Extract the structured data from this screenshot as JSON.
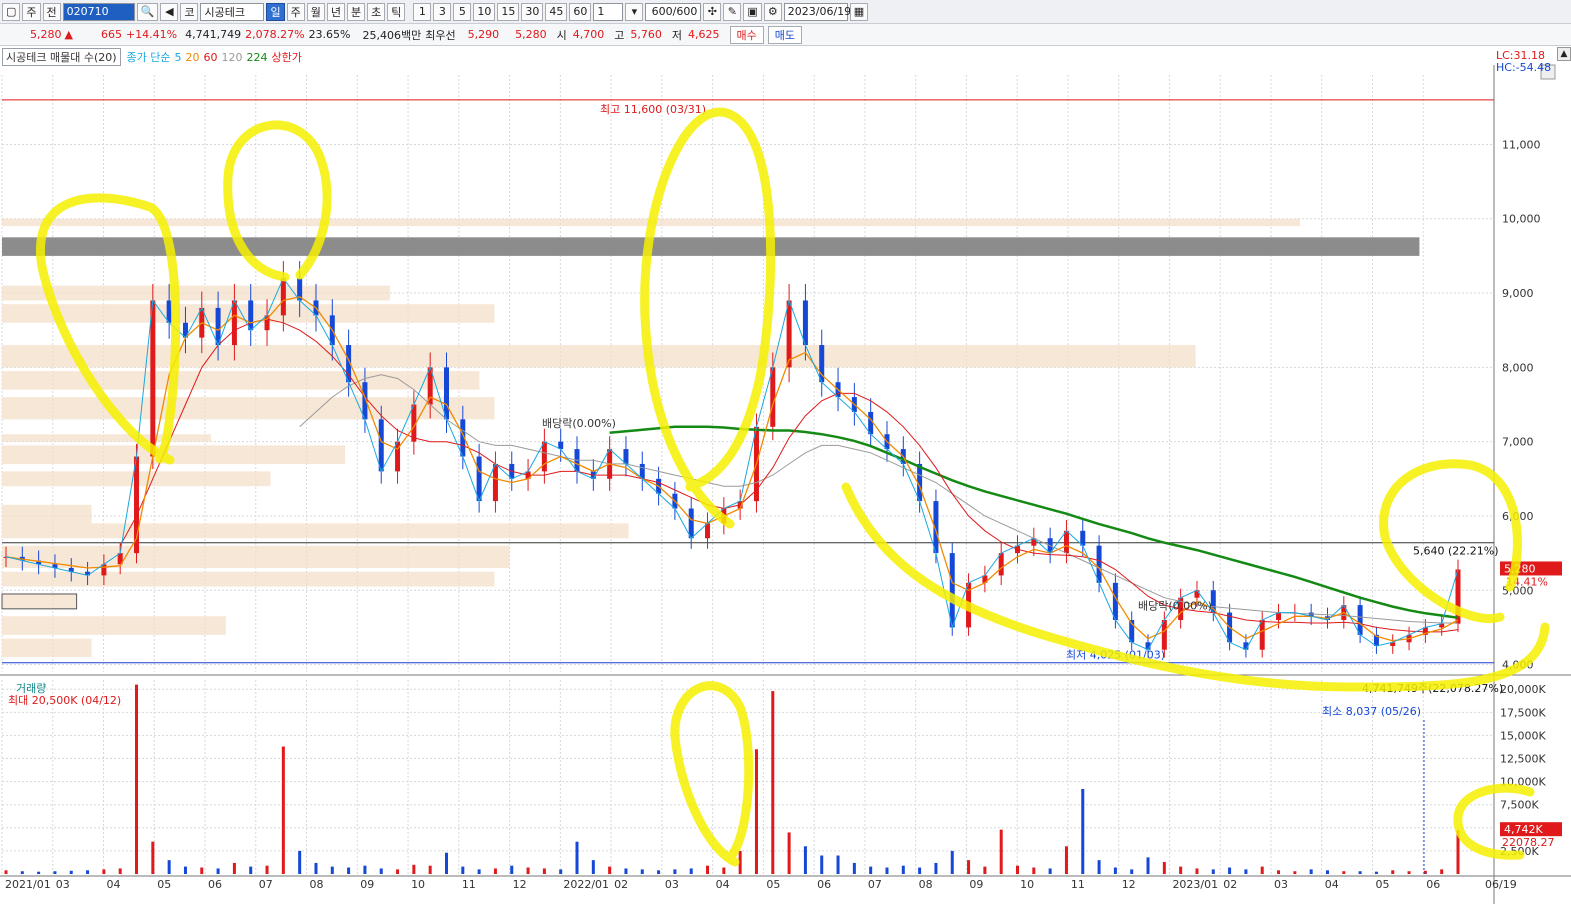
{
  "toolbar": {
    "market_label": "주",
    "prev_label": "전",
    "stock_code": "020710",
    "code_type": "코",
    "stock_name": "시공테크",
    "periods": [
      "일",
      "주",
      "월",
      "년",
      "분",
      "초",
      "틱"
    ],
    "selected_period": "일",
    "intervals": [
      "1",
      "3",
      "5",
      "10",
      "15",
      "30",
      "45",
      "60"
    ],
    "multiplier": "1",
    "count": "600/600",
    "date": "2023/06/19"
  },
  "quote": {
    "price": "5,280",
    "arrow": "▲",
    "change": "665",
    "change_pct": "+14.41%",
    "volume": "4,741,749",
    "volume_pct": "2,078.27%",
    "turnover": "23.65%",
    "amount": "25,406백만",
    "best_bid_label": "최우선",
    "best_ask": "5,290",
    "best_bid": "5,280",
    "open_label": "시",
    "open": "4,700",
    "high_label": "고",
    "high": "5,760",
    "low_label": "저",
    "low": "4,625",
    "buy_label": "매수",
    "sell_label": "매도"
  },
  "legend": {
    "name": "시공테크 매물대 수(20)",
    "ma_label": "종가 단순",
    "ma_periods": [
      {
        "label": "5",
        "color": "#19a8e0"
      },
      {
        "label": "20",
        "color": "#f08a00"
      },
      {
        "label": "60",
        "color": "#e0191b"
      },
      {
        "label": "120",
        "color": "#9a9a9a"
      },
      {
        "label": "224",
        "color": "#148a14"
      }
    ],
    "upper_limit": "상한가"
  },
  "indicators": {
    "lc": "LC:31.18",
    "hc": "HC:-54.48"
  },
  "chart_data": [
    {
      "type": "candlestick",
      "title": "",
      "ylim": [
        3900,
        11800
      ],
      "y_ticks": [
        "11,000",
        "10,000",
        "9,000",
        "8,000",
        "7,000",
        "6,000",
        "5,000",
        "4,000"
      ],
      "y_tick_values": [
        11000,
        10000,
        9000,
        8000,
        7000,
        6000,
        5000,
        4000
      ],
      "x_ticks": [
        "2021/01",
        "03",
        "04",
        "05",
        "06",
        "07",
        "08",
        "09",
        "10",
        "11",
        "12",
        "2022/01",
        "02",
        "03",
        "04",
        "05",
        "06",
        "07",
        "08",
        "09",
        "10",
        "11",
        "12",
        "2023/01",
        "02",
        "03",
        "04",
        "05",
        "06",
        "06/19"
      ],
      "close_series": [
        5450,
        5400,
        5350,
        5300,
        5250,
        5200,
        5350,
        5500,
        6800,
        8900,
        8600,
        8400,
        8800,
        8300,
        8900,
        8500,
        8700,
        9200,
        8900,
        8700,
        8300,
        7800,
        7300,
        6600,
        7000,
        7500,
        8000,
        7300,
        6800,
        6200,
        6700,
        6500,
        6600,
        7000,
        6900,
        6600,
        6500,
        6900,
        6700,
        6500,
        6300,
        6100,
        5700,
        5900,
        6100,
        6200,
        7200,
        8000,
        8900,
        8300,
        7800,
        7600,
        7400,
        7100,
        6900,
        6700,
        6200,
        5500,
        4500,
        5100,
        5200,
        5500,
        5600,
        5700,
        5500,
        5800,
        5600,
        5100,
        4600,
        4300,
        4200,
        4600,
        4900,
        5000,
        4700,
        4300,
        4200,
        4600,
        4700,
        4700,
        4650,
        4600,
        4800,
        4400,
        4250,
        4300,
        4400,
        4500,
        4550,
        5280
      ],
      "ma_values": {
        "ma20": [
          5450,
          5420,
          5390,
          5360,
          5330,
          5300,
          5310,
          5330,
          5700,
          6800,
          7900,
          8400,
          8600,
          8500,
          8700,
          8600,
          8650,
          8900,
          8950,
          8800,
          8500,
          8100,
          7600,
          7000,
          6900,
          7200,
          7600,
          7500,
          7100,
          6600,
          6500,
          6450,
          6500,
          6700,
          6800,
          6700,
          6600,
          6700,
          6650,
          6500,
          6400,
          6200,
          5950,
          5900,
          6000,
          6100,
          6700,
          7500,
          8100,
          8200,
          7900,
          7700,
          7500,
          7300,
          7000,
          6800,
          6400,
          5800,
          5100,
          5000,
          5100,
          5300,
          5450,
          5550,
          5500,
          5600,
          5500,
          5300,
          4900,
          4550,
          4350,
          4450,
          4700,
          4850,
          4750,
          4500,
          4350,
          4450,
          4550,
          4650,
          4650,
          4620,
          4700,
          4550,
          4380,
          4320,
          4350,
          4420,
          4480,
          4600
        ],
        "ma60": [
          null,
          null,
          null,
          null,
          null,
          null,
          null,
          5600,
          6000,
          6500,
          7000,
          7500,
          8000,
          8300,
          8500,
          8600,
          8650,
          8600,
          8500,
          8350,
          8150,
          7900,
          7600,
          7350,
          7150,
          7050,
          7000,
          7000,
          6950,
          6850,
          6700,
          6600,
          6550,
          6550,
          6600,
          6600,
          6550,
          6550,
          6550,
          6500,
          6450,
          6350,
          6250,
          6150,
          6100,
          6150,
          6350,
          6650,
          7050,
          7350,
          7550,
          7650,
          7650,
          7550,
          7400,
          7200,
          6950,
          6650,
          6300,
          6000,
          5800,
          5650,
          5550,
          5500,
          5480,
          5470,
          5450,
          5400,
          5280,
          5100,
          4920,
          4800,
          4750,
          4720,
          4700,
          4650,
          4600,
          4580,
          4570,
          4570,
          4560,
          4560,
          4570,
          4550,
          4500,
          4470,
          4450,
          4440,
          4440,
          4470
        ],
        "ma120": [
          null,
          null,
          null,
          null,
          null,
          null,
          null,
          null,
          null,
          null,
          null,
          null,
          null,
          null,
          null,
          null,
          null,
          null,
          7200,
          7400,
          7600,
          7750,
          7850,
          7900,
          7850,
          7700,
          7500,
          7300,
          7150,
          7000,
          6950,
          6950,
          6900,
          6850,
          6800,
          6750,
          6750,
          6700,
          6700,
          6650,
          6600,
          6550,
          6500,
          6450,
          6400,
          6400,
          6450,
          6550,
          6700,
          6850,
          6950,
          6950,
          6900,
          6850,
          6750,
          6650,
          6550,
          6450,
          6300,
          6150,
          6000,
          5900,
          5800,
          5700,
          5600,
          5500,
          5400,
          5300,
          5200,
          5100,
          5000,
          4900,
          4850,
          4800,
          4780,
          4760,
          4740,
          4720,
          4700,
          4690,
          4680,
          4670,
          4660,
          4640,
          4620,
          4600,
          4580,
          4570,
          4560,
          4560
        ],
        "ma224": [
          null,
          null,
          null,
          null,
          null,
          null,
          null,
          null,
          null,
          null,
          null,
          null,
          null,
          null,
          null,
          null,
          null,
          null,
          null,
          null,
          null,
          null,
          null,
          null,
          null,
          null,
          null,
          null,
          null,
          null,
          null,
          null,
          null,
          null,
          null,
          null,
          null,
          7120,
          7140,
          7160,
          7180,
          7200,
          7200,
          7200,
          7190,
          7170,
          7160,
          7150,
          7150,
          7130,
          7100,
          7060,
          7010,
          6940,
          6850,
          6760,
          6660,
          6570,
          6480,
          6400,
          6330,
          6270,
          6210,
          6150,
          6090,
          6030,
          5960,
          5890,
          5830,
          5770,
          5700,
          5640,
          5590,
          5540,
          5480,
          5420,
          5360,
          5300,
          5240,
          5180,
          5110,
          5040,
          4970,
          4900,
          4840,
          4780,
          4730,
          4690,
          4660,
          4630
        ]
      },
      "annotations": {
        "high": "최고 11,600 (03/31)",
        "low": "최저 4,025 (01/03)",
        "dividend_1": "배당락(0.00%)",
        "dividend_2": "배당락(0.00%)",
        "resistance": "5,640 (22.21%)",
        "current_price": "5,280",
        "current_pct": "14.41%"
      },
      "high_line": 11600,
      "low_line": 4025,
      "resistance_line": 5640,
      "volume_profile": [
        {
          "price_low": 9900,
          "price_high": 10000,
          "rel": 0.87
        },
        {
          "price_low": 8900,
          "price_high": 9100,
          "rel": 0.26
        },
        {
          "price_low": 8600,
          "price_high": 8850,
          "rel": 0.33
        },
        {
          "price_low": 8000,
          "price_high": 8300,
          "rel": 0.8
        },
        {
          "price_low": 7700,
          "price_high": 7950,
          "rel": 0.32
        },
        {
          "price_low": 7300,
          "price_high": 7600,
          "rel": 0.33
        },
        {
          "price_low": 7000,
          "price_high": 7100,
          "rel": 0.14
        },
        {
          "price_low": 6700,
          "price_high": 6950,
          "rel": 0.23
        },
        {
          "price_low": 6400,
          "price_high": 6600,
          "rel": 0.18
        },
        {
          "price_low": 5900,
          "price_high": 6150,
          "rel": 0.06
        },
        {
          "price_low": 5700,
          "price_high": 5900,
          "rel": 0.42
        },
        {
          "price_low": 5300,
          "price_high": 5600,
          "rel": 0.34
        },
        {
          "price_low": 5050,
          "price_high": 5250,
          "rel": 0.33
        },
        {
          "price_low": 4750,
          "price_high": 4950,
          "rel": 0.05
        },
        {
          "price_low": 4400,
          "price_high": 4650,
          "rel": 0.15
        },
        {
          "price_low": 4100,
          "price_high": 4350,
          "rel": 0.06
        }
      ]
    },
    {
      "type": "bar",
      "title": "거래량",
      "ylim": [
        0,
        21000
      ],
      "y_ticks": [
        "20,000K",
        "17,500K",
        "15,000K",
        "12,500K",
        "10,000K",
        "7,500K",
        "5,000K",
        "2,500K"
      ],
      "y_tick_values": [
        20000,
        17500,
        15000,
        12500,
        10000,
        7500,
        5000,
        2500
      ],
      "unit": "K",
      "values_k": [
        400,
        300,
        250,
        300,
        350,
        400,
        500,
        600,
        20500,
        3500,
        1500,
        800,
        700,
        600,
        1200,
        800,
        900,
        13800,
        2500,
        1200,
        800,
        700,
        900,
        600,
        500,
        1000,
        900,
        2300,
        800,
        500,
        600,
        900,
        700,
        600,
        500,
        3500,
        1500,
        800,
        600,
        500,
        400,
        500,
        600,
        900,
        700,
        2500,
        13500,
        19800,
        4500,
        3000,
        2000,
        2000,
        1200,
        800,
        700,
        900,
        700,
        1200,
        2500,
        1500,
        800,
        4800,
        900,
        700,
        600,
        3000,
        9200,
        1500,
        700,
        500,
        1800,
        1300,
        800,
        600,
        500,
        700,
        500,
        800,
        400,
        300,
        500,
        400,
        300,
        300,
        250,
        400,
        300,
        350,
        500,
        4742
      ],
      "annotations": {
        "max": "최대 20,500K (04/12)",
        "current": "4,741,749주(22,078.27%)",
        "current_short": "4,742K",
        "current_pct": "22078.27",
        "min": "최소 8,037 (05/26)"
      }
    }
  ]
}
